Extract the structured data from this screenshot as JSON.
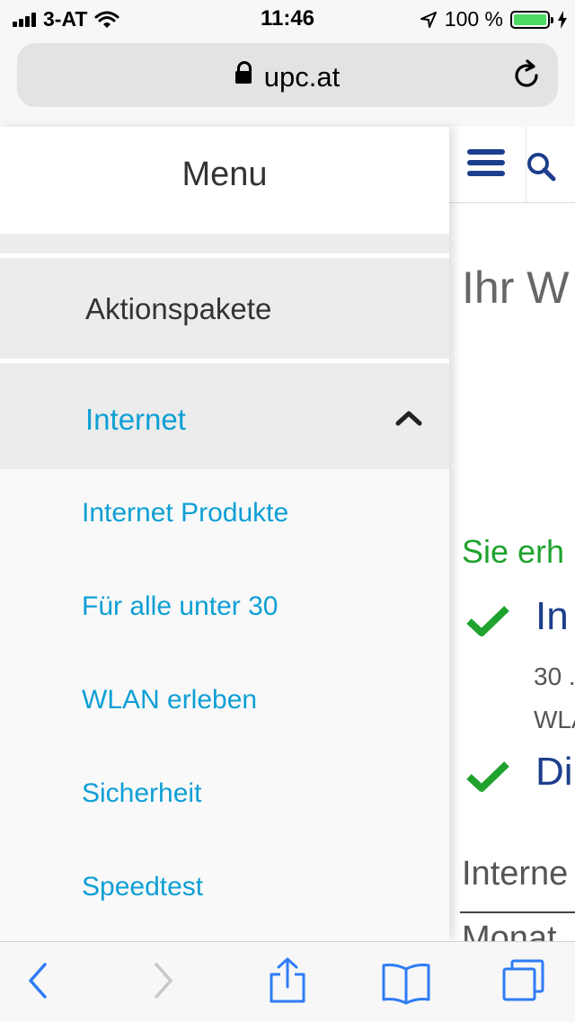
{
  "status_bar": {
    "carrier": "3-AT",
    "time": "11:46",
    "battery": "100 %",
    "battery_level": 1.0,
    "signal_icon": "signal-bars-icon",
    "wifi_icon": "wifi-icon",
    "location_icon": "location-arrow-icon",
    "charging_icon": "charging-bolt-icon"
  },
  "browser": {
    "url": "upc.at",
    "lock_icon": "lock-icon",
    "reload_icon": "reload-icon"
  },
  "menu": {
    "title": "Menu",
    "items": [
      {
        "label": "Aktionspakete",
        "active": false
      },
      {
        "label": "Internet",
        "active": true,
        "expanded": true
      }
    ],
    "sub_items": [
      {
        "label": "Internet Produkte"
      },
      {
        "label": "Für alle unter 30"
      },
      {
        "label": "WLAN erleben"
      },
      {
        "label": "Sicherheit"
      },
      {
        "label": "Speedtest"
      }
    ]
  },
  "page": {
    "title": "Ihr W",
    "green_text": "Sie erh",
    "feature_1": "In",
    "feature_1_line_1": "30 .",
    "feature_1_line_2": "WLA",
    "feature_2": "Di",
    "section": "Interne",
    "footer_cut": "Monat"
  },
  "colors": {
    "accent_blue": "#0e9fd5",
    "brand_navy": "#1d3e8c",
    "success_green": "#1fa22e",
    "ios_blue": "#2f7cf6"
  },
  "toolbar": {
    "back_icon": "back-chevron-icon",
    "forward_icon": "forward-chevron-icon",
    "share_icon": "share-icon",
    "bookmarks_icon": "bookmarks-icon",
    "tabs_icon": "tabs-icon"
  }
}
